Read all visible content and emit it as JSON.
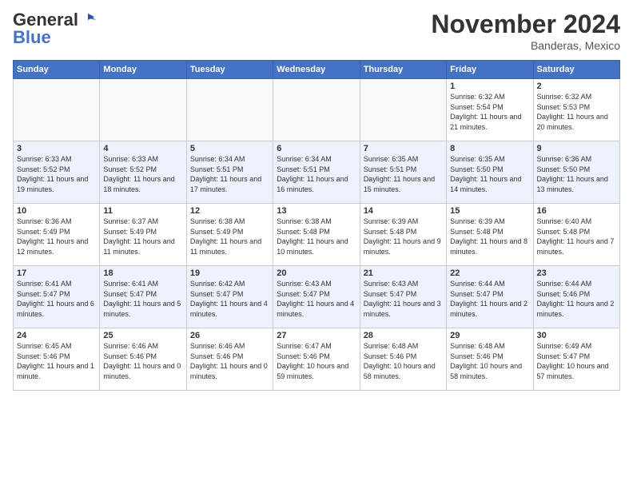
{
  "header": {
    "logo_general": "General",
    "logo_blue": "Blue",
    "month_title": "November 2024",
    "location": "Banderas, Mexico"
  },
  "weekdays": [
    "Sunday",
    "Monday",
    "Tuesday",
    "Wednesday",
    "Thursday",
    "Friday",
    "Saturday"
  ],
  "weeks": [
    [
      {
        "day": "",
        "sunrise": "",
        "sunset": "",
        "daylight": "",
        "empty": true
      },
      {
        "day": "",
        "sunrise": "",
        "sunset": "",
        "daylight": "",
        "empty": true
      },
      {
        "day": "",
        "sunrise": "",
        "sunset": "",
        "daylight": "",
        "empty": true
      },
      {
        "day": "",
        "sunrise": "",
        "sunset": "",
        "daylight": "",
        "empty": true
      },
      {
        "day": "",
        "sunrise": "",
        "sunset": "",
        "daylight": "",
        "empty": true
      },
      {
        "day": "1",
        "sunrise": "Sunrise: 6:32 AM",
        "sunset": "Sunset: 5:54 PM",
        "daylight": "Daylight: 11 hours and 21 minutes.",
        "empty": false
      },
      {
        "day": "2",
        "sunrise": "Sunrise: 6:32 AM",
        "sunset": "Sunset: 5:53 PM",
        "daylight": "Daylight: 11 hours and 20 minutes.",
        "empty": false
      }
    ],
    [
      {
        "day": "3",
        "sunrise": "Sunrise: 6:33 AM",
        "sunset": "Sunset: 5:52 PM",
        "daylight": "Daylight: 11 hours and 19 minutes.",
        "empty": false
      },
      {
        "day": "4",
        "sunrise": "Sunrise: 6:33 AM",
        "sunset": "Sunset: 5:52 PM",
        "daylight": "Daylight: 11 hours and 18 minutes.",
        "empty": false
      },
      {
        "day": "5",
        "sunrise": "Sunrise: 6:34 AM",
        "sunset": "Sunset: 5:51 PM",
        "daylight": "Daylight: 11 hours and 17 minutes.",
        "empty": false
      },
      {
        "day": "6",
        "sunrise": "Sunrise: 6:34 AM",
        "sunset": "Sunset: 5:51 PM",
        "daylight": "Daylight: 11 hours and 16 minutes.",
        "empty": false
      },
      {
        "day": "7",
        "sunrise": "Sunrise: 6:35 AM",
        "sunset": "Sunset: 5:51 PM",
        "daylight": "Daylight: 11 hours and 15 minutes.",
        "empty": false
      },
      {
        "day": "8",
        "sunrise": "Sunrise: 6:35 AM",
        "sunset": "Sunset: 5:50 PM",
        "daylight": "Daylight: 11 hours and 14 minutes.",
        "empty": false
      },
      {
        "day": "9",
        "sunrise": "Sunrise: 6:36 AM",
        "sunset": "Sunset: 5:50 PM",
        "daylight": "Daylight: 11 hours and 13 minutes.",
        "empty": false
      }
    ],
    [
      {
        "day": "10",
        "sunrise": "Sunrise: 6:36 AM",
        "sunset": "Sunset: 5:49 PM",
        "daylight": "Daylight: 11 hours and 12 minutes.",
        "empty": false
      },
      {
        "day": "11",
        "sunrise": "Sunrise: 6:37 AM",
        "sunset": "Sunset: 5:49 PM",
        "daylight": "Daylight: 11 hours and 11 minutes.",
        "empty": false
      },
      {
        "day": "12",
        "sunrise": "Sunrise: 6:38 AM",
        "sunset": "Sunset: 5:49 PM",
        "daylight": "Daylight: 11 hours and 11 minutes.",
        "empty": false
      },
      {
        "day": "13",
        "sunrise": "Sunrise: 6:38 AM",
        "sunset": "Sunset: 5:48 PM",
        "daylight": "Daylight: 11 hours and 10 minutes.",
        "empty": false
      },
      {
        "day": "14",
        "sunrise": "Sunrise: 6:39 AM",
        "sunset": "Sunset: 5:48 PM",
        "daylight": "Daylight: 11 hours and 9 minutes.",
        "empty": false
      },
      {
        "day": "15",
        "sunrise": "Sunrise: 6:39 AM",
        "sunset": "Sunset: 5:48 PM",
        "daylight": "Daylight: 11 hours and 8 minutes.",
        "empty": false
      },
      {
        "day": "16",
        "sunrise": "Sunrise: 6:40 AM",
        "sunset": "Sunset: 5:48 PM",
        "daylight": "Daylight: 11 hours and 7 minutes.",
        "empty": false
      }
    ],
    [
      {
        "day": "17",
        "sunrise": "Sunrise: 6:41 AM",
        "sunset": "Sunset: 5:47 PM",
        "daylight": "Daylight: 11 hours and 6 minutes.",
        "empty": false
      },
      {
        "day": "18",
        "sunrise": "Sunrise: 6:41 AM",
        "sunset": "Sunset: 5:47 PM",
        "daylight": "Daylight: 11 hours and 5 minutes.",
        "empty": false
      },
      {
        "day": "19",
        "sunrise": "Sunrise: 6:42 AM",
        "sunset": "Sunset: 5:47 PM",
        "daylight": "Daylight: 11 hours and 4 minutes.",
        "empty": false
      },
      {
        "day": "20",
        "sunrise": "Sunrise: 6:43 AM",
        "sunset": "Sunset: 5:47 PM",
        "daylight": "Daylight: 11 hours and 4 minutes.",
        "empty": false
      },
      {
        "day": "21",
        "sunrise": "Sunrise: 6:43 AM",
        "sunset": "Sunset: 5:47 PM",
        "daylight": "Daylight: 11 hours and 3 minutes.",
        "empty": false
      },
      {
        "day": "22",
        "sunrise": "Sunrise: 6:44 AM",
        "sunset": "Sunset: 5:47 PM",
        "daylight": "Daylight: 11 hours and 2 minutes.",
        "empty": false
      },
      {
        "day": "23",
        "sunrise": "Sunrise: 6:44 AM",
        "sunset": "Sunset: 5:46 PM",
        "daylight": "Daylight: 11 hours and 2 minutes.",
        "empty": false
      }
    ],
    [
      {
        "day": "24",
        "sunrise": "Sunrise: 6:45 AM",
        "sunset": "Sunset: 5:46 PM",
        "daylight": "Daylight: 11 hours and 1 minute.",
        "empty": false
      },
      {
        "day": "25",
        "sunrise": "Sunrise: 6:46 AM",
        "sunset": "Sunset: 5:46 PM",
        "daylight": "Daylight: 11 hours and 0 minutes.",
        "empty": false
      },
      {
        "day": "26",
        "sunrise": "Sunrise: 6:46 AM",
        "sunset": "Sunset: 5:46 PM",
        "daylight": "Daylight: 11 hours and 0 minutes.",
        "empty": false
      },
      {
        "day": "27",
        "sunrise": "Sunrise: 6:47 AM",
        "sunset": "Sunset: 5:46 PM",
        "daylight": "Daylight: 10 hours and 59 minutes.",
        "empty": false
      },
      {
        "day": "28",
        "sunrise": "Sunrise: 6:48 AM",
        "sunset": "Sunset: 5:46 PM",
        "daylight": "Daylight: 10 hours and 58 minutes.",
        "empty": false
      },
      {
        "day": "29",
        "sunrise": "Sunrise: 6:48 AM",
        "sunset": "Sunset: 5:46 PM",
        "daylight": "Daylight: 10 hours and 58 minutes.",
        "empty": false
      },
      {
        "day": "30",
        "sunrise": "Sunrise: 6:49 AM",
        "sunset": "Sunset: 5:47 PM",
        "daylight": "Daylight: 10 hours and 57 minutes.",
        "empty": false
      }
    ]
  ]
}
